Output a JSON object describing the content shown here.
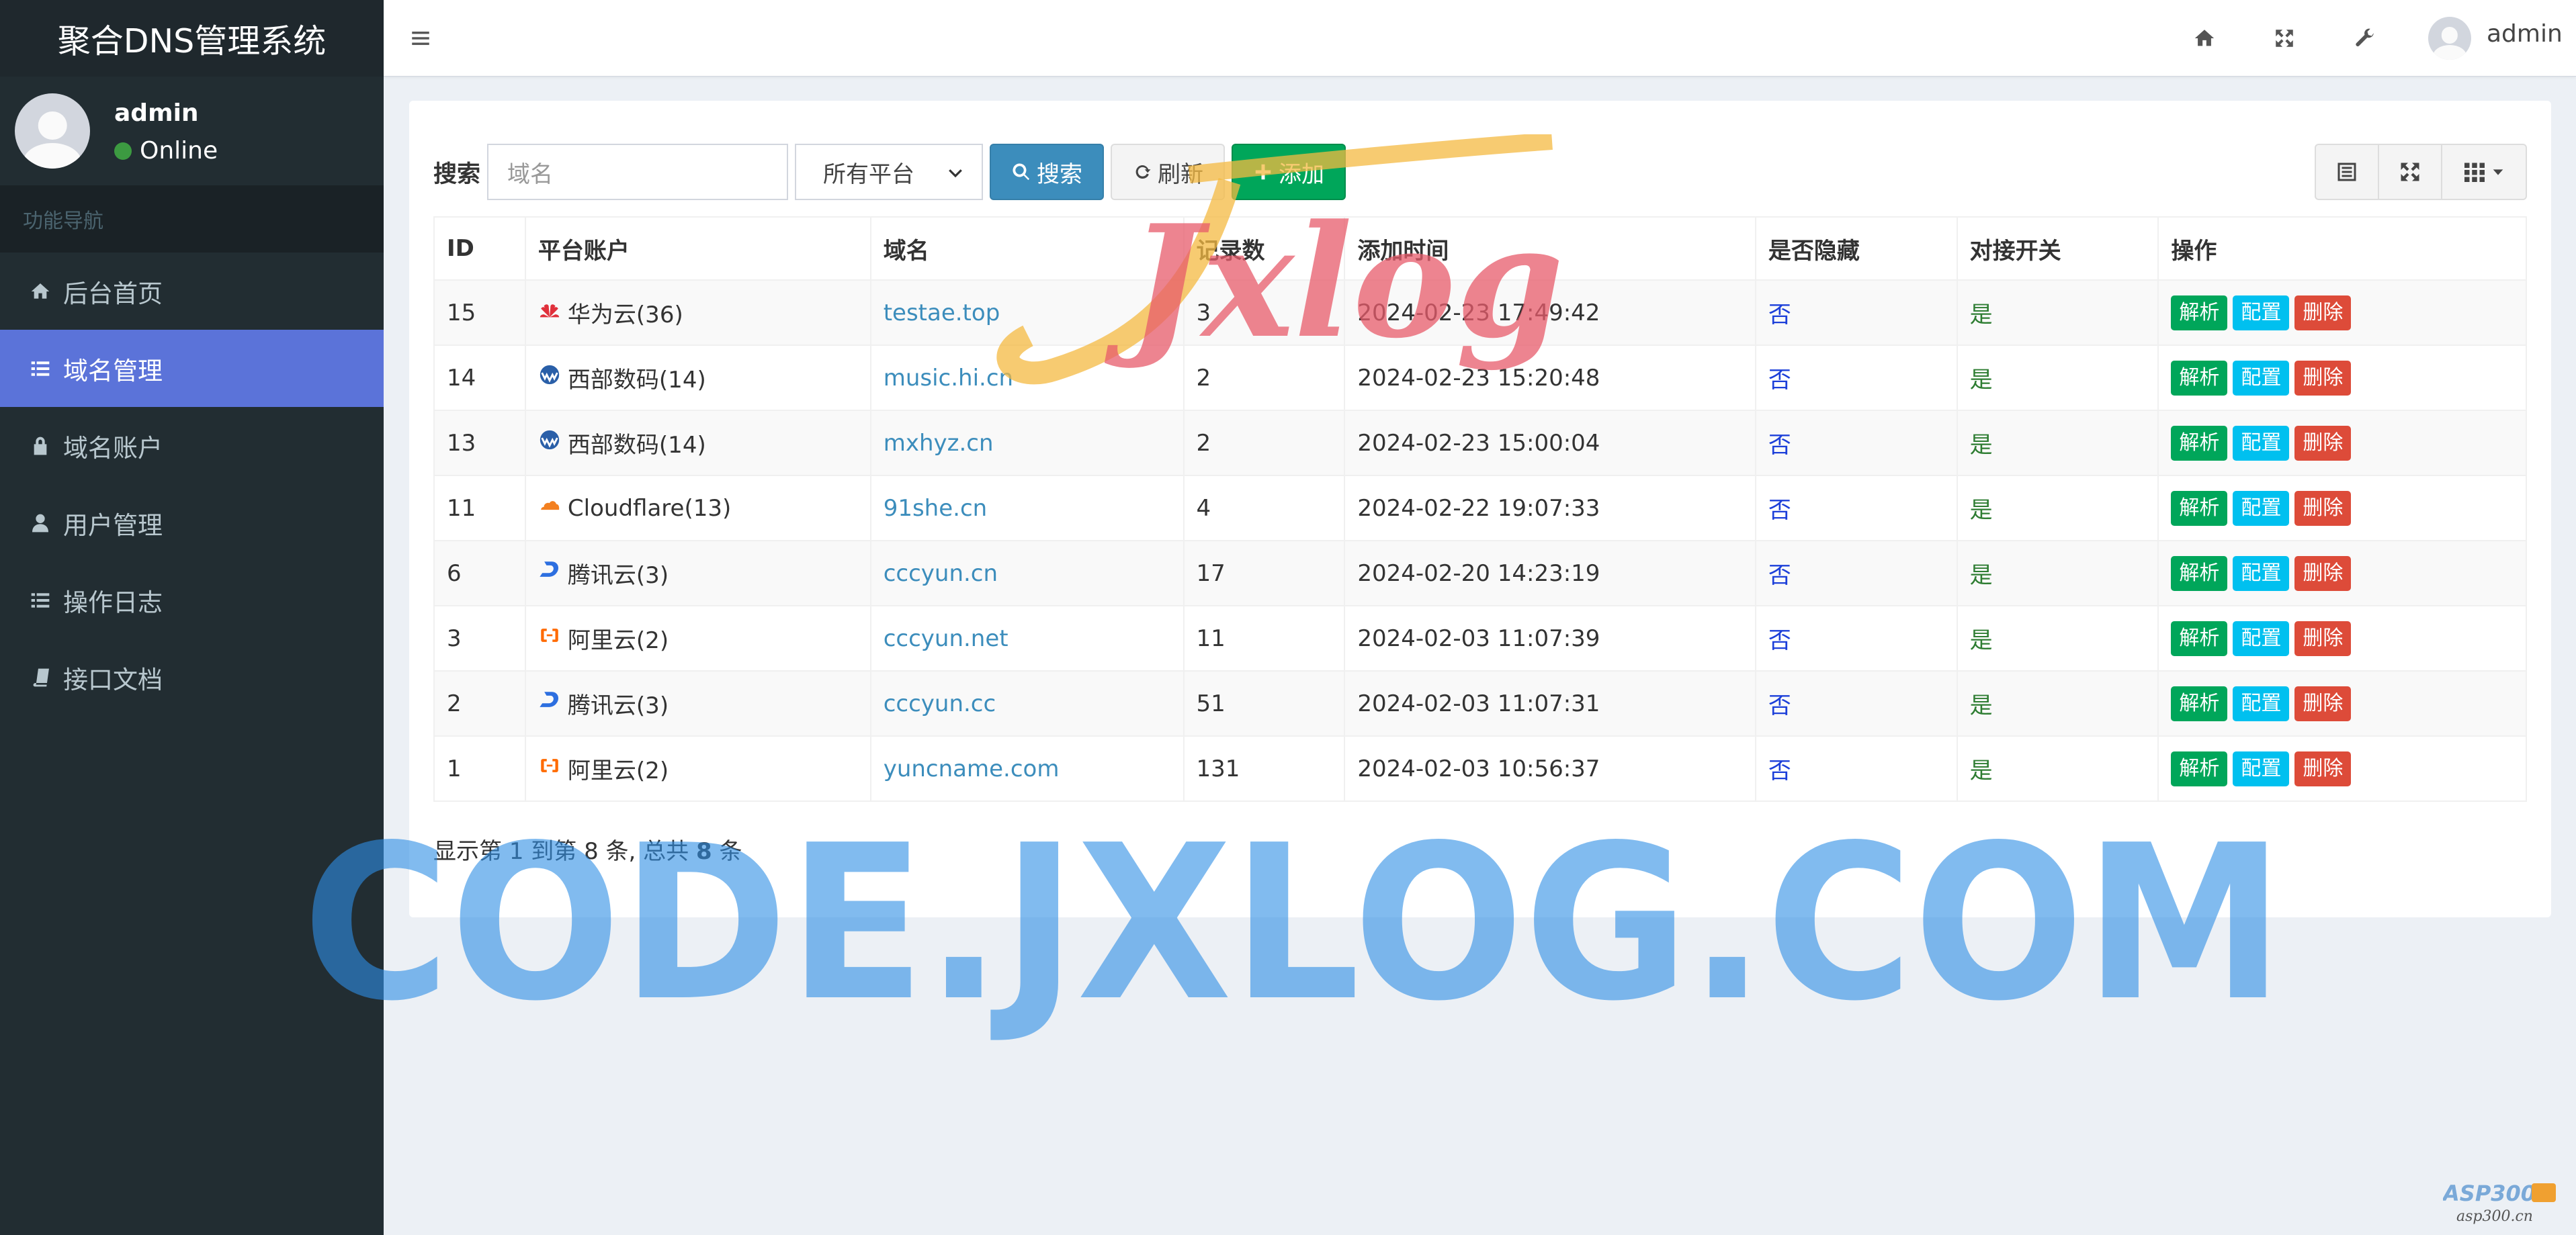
{
  "app": {
    "title": "聚合DNS管理系统"
  },
  "user": {
    "name": "admin",
    "status": "Online"
  },
  "sidebar": {
    "header": "功能导航",
    "items": [
      {
        "label": "后台首页",
        "icon": "home-icon"
      },
      {
        "label": "域名管理",
        "icon": "list-icon",
        "active": true
      },
      {
        "label": "域名账户",
        "icon": "lock-icon"
      },
      {
        "label": "用户管理",
        "icon": "user-icon"
      },
      {
        "label": "操作日志",
        "icon": "list-icon"
      },
      {
        "label": "接口文档",
        "icon": "book-icon"
      }
    ]
  },
  "topbar": {
    "user_name": "admin"
  },
  "toolbar": {
    "search_label": "搜索",
    "search_placeholder": "域名",
    "platform_select": "所有平台",
    "search_button": "搜索",
    "refresh_button": "刷新",
    "add_button": "添加"
  },
  "table": {
    "columns": [
      "ID",
      "平台账户",
      "域名",
      "记录数",
      "添加时间",
      "是否隐藏",
      "对接开关",
      "操作"
    ],
    "rows": [
      {
        "id": "15",
        "platform": "华为云(36)",
        "platform_icon": "huawei-icon",
        "domain": "testae.top",
        "records": "3",
        "added": "2024-02-23 17:49:42",
        "hidden": "否",
        "enabled": "是"
      },
      {
        "id": "14",
        "platform": "西部数码(14)",
        "platform_icon": "west-icon",
        "domain": "music.hi.cn",
        "records": "2",
        "added": "2024-02-23 15:20:48",
        "hidden": "否",
        "enabled": "是"
      },
      {
        "id": "13",
        "platform": "西部数码(14)",
        "platform_icon": "west-icon",
        "domain": "mxhyz.cn",
        "records": "2",
        "added": "2024-02-23 15:00:04",
        "hidden": "否",
        "enabled": "是"
      },
      {
        "id": "11",
        "platform": "Cloudflare(13)",
        "platform_icon": "cloudflare-icon",
        "domain": "91she.cn",
        "records": "4",
        "added": "2024-02-22 19:07:33",
        "hidden": "否",
        "enabled": "是"
      },
      {
        "id": "6",
        "platform": "腾讯云(3)",
        "platform_icon": "dnspod-icon",
        "domain": "cccyun.cn",
        "records": "17",
        "added": "2024-02-20 14:23:19",
        "hidden": "否",
        "enabled": "是"
      },
      {
        "id": "3",
        "platform": "阿里云(2)",
        "platform_icon": "aliyun-icon",
        "domain": "cccyun.net",
        "records": "11",
        "added": "2024-02-03 11:07:39",
        "hidden": "否",
        "enabled": "是"
      },
      {
        "id": "2",
        "platform": "腾讯云(3)",
        "platform_icon": "dnspod-icon",
        "domain": "cccyun.cc",
        "records": "51",
        "added": "2024-02-03 11:07:31",
        "hidden": "否",
        "enabled": "是"
      },
      {
        "id": "1",
        "platform": "阿里云(2)",
        "platform_icon": "aliyun-icon",
        "domain": "yuncname.com",
        "records": "131",
        "added": "2024-02-03 10:56:37",
        "hidden": "否",
        "enabled": "是"
      }
    ],
    "actions": {
      "resolve": "解析",
      "config": "配置",
      "delete": "删除"
    }
  },
  "pagination": {
    "prefix": "显示第",
    "from": "1",
    "mid": "到第",
    "to": "8",
    "mid2": "条, 总共",
    "total": "8",
    "suffix": "条"
  },
  "watermarks": {
    "logo": "Jxlog",
    "big": "CODE.JXLOG.COM",
    "corner_top": "ASP300",
    "corner_bottom": "asp300.cn"
  }
}
